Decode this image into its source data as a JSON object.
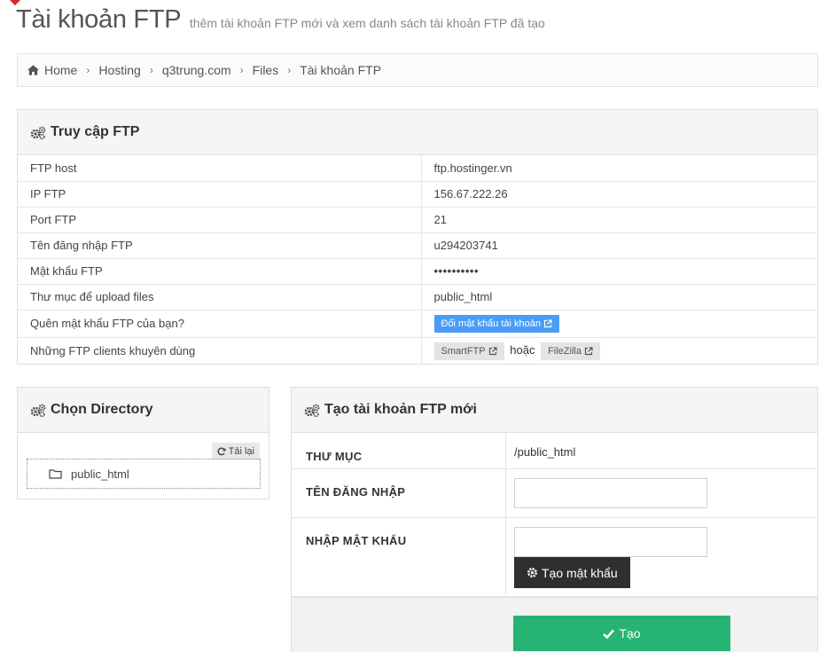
{
  "header": {
    "title": "Tài khoản FTP",
    "subtitle": "thêm tài khoản FTP mới và xem danh sách tài khoản FTP đã tạo"
  },
  "breadcrumb": {
    "items": [
      "Home",
      "Hosting",
      "q3trung.com",
      "Files"
    ],
    "current": "Tài khoản FTP",
    "separator": "›"
  },
  "ftp_access": {
    "title": "Truy cập FTP",
    "rows": [
      {
        "label": "FTP host",
        "value": "ftp.hostinger.vn"
      },
      {
        "label": "IP FTP",
        "value": "156.67.222.26"
      },
      {
        "label": "Port FTP",
        "value": "21"
      },
      {
        "label": "Tên đăng nhập FTP",
        "value": "u294203741"
      },
      {
        "label": "Mật khẩu FTP",
        "value": "••••••••••"
      },
      {
        "label": "Thư mục để upload files",
        "value": "public_html"
      },
      {
        "label": "Quên mật khẩu FTP của bạn?",
        "button": "Đổi mật khẩu tài khoản"
      },
      {
        "label": "Những FTP clients khuyên dùng",
        "client1": "SmartFTP",
        "or": "hoặc",
        "client2": "FileZilla"
      }
    ]
  },
  "directory": {
    "title": "Chọn Directory",
    "reload_label": "Tải lại",
    "folder": "public_html"
  },
  "create_account": {
    "title": "Tạo tài khoản FTP mới",
    "dir_label": "THƯ MỤC",
    "dir_value": "/public_html",
    "username_label": "TÊN ĐĂNG NHẬP",
    "username_value": "",
    "password_label": "NHẬP MẬT KHẨU",
    "password_value": "",
    "generate_label": "Tạo mật khẩu",
    "submit_label": "Tạo"
  },
  "colors": {
    "accent_blue": "#4a9cf5",
    "submit_green": "#27b374",
    "dark_button": "#2f2f2f",
    "corner_red": "#d9262c"
  },
  "icons": [
    "home-icon",
    "cogs-icon",
    "external-link-icon",
    "refresh-icon",
    "folder-icon",
    "gear-icon",
    "check-icon"
  ]
}
